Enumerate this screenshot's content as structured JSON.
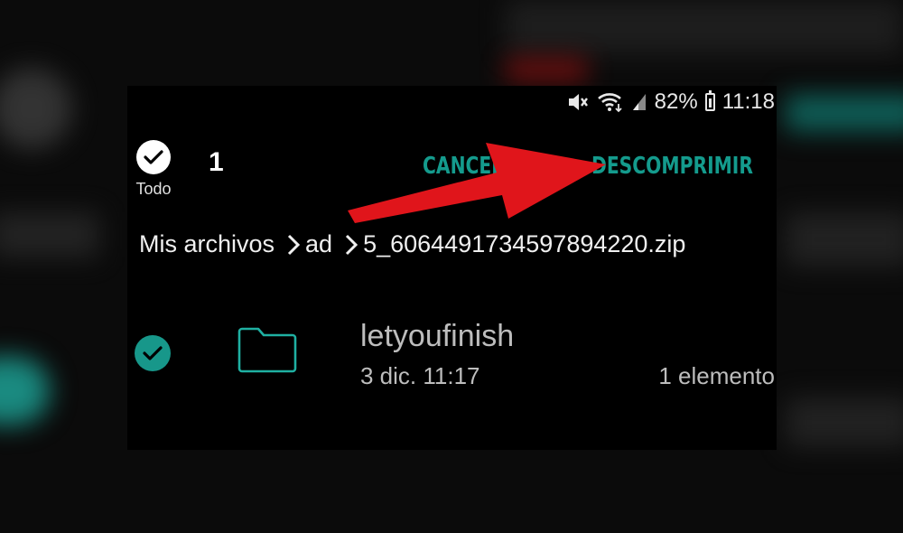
{
  "status_bar": {
    "battery": "82%",
    "time": "11:18",
    "icons": [
      "mute-icon",
      "wifi-icon",
      "signal-icon",
      "battery-icon"
    ]
  },
  "toolbar": {
    "select_all_label": "Todo",
    "selected_count": "1",
    "cancel_label": "CANCELAR",
    "decompress_label": "DESCOMPRIMIR"
  },
  "breadcrumb": {
    "items": [
      "Mis archivos",
      "ad",
      "5_6064491734597894220.zip"
    ]
  },
  "file_list": [
    {
      "name": "letyoufinish",
      "date": "3 dic. 11:17",
      "items": "1 elemento",
      "selected": true,
      "icon": "folder-icon"
    }
  ],
  "colors": {
    "accent": "#149b8d",
    "arrow": "#e0151b",
    "background": "#000000"
  }
}
